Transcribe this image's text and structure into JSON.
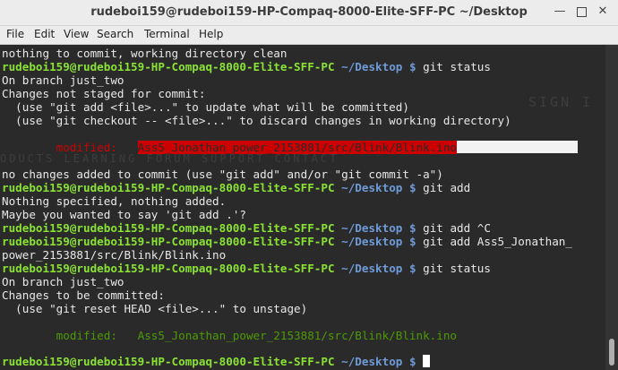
{
  "window": {
    "title": "rudeboi159@rudeboi159-HP-Compaq-8000-Elite-SFF-PC ~/Desktop"
  },
  "menu": [
    "File",
    "Edit",
    "View",
    "Search",
    "Terminal",
    "Help"
  ],
  "prompt": {
    "user": "rudeboi159@rudeboi159-HP-Compaq-8000-Elite-SFF-PC",
    "path": "~/Desktop",
    "symbol": "$"
  },
  "background_ghost": {
    "top": "SIGN I",
    "bottom": "ODUCTS   LEARNING   FORUM   SUPPORT   CONTACT"
  },
  "output": {
    "line1": "nothing to commit, working directory clean",
    "line3": "On branch just_two",
    "line4": "Changes not staged for commit:",
    "line5": "  (use \"git add <file>...\" to update what will be committed)",
    "line6": "  (use \"git checkout -- <file>...\" to discard changes in working directory)",
    "mod_label": "        modified:   ",
    "mod_file": "Ass5_Jonathan_power_2153881/src/Blink/Blink.ino",
    "line9": "no changes added to commit (use \"git add\" and/or \"git commit -a\")",
    "line11": "Nothing specified, nothing added.",
    "line12": "Maybe you wanted to say 'git add .'?",
    "line15": "power_2153881/src/Blink/Blink.ino",
    "line17": "On branch just_two",
    "line18": "Changes to be committed:",
    "line19": "  (use \"git reset HEAD <file>...\" to unstage)",
    "mod2_line": "        modified:   Ass5_Jonathan_power_2153881/src/Blink/Blink.ino"
  },
  "commands": {
    "c2": " git status",
    "c10": " git add",
    "c13": " git add ^C",
    "c14": " git add Ass5_Jonathan_",
    "c16": " git status",
    "c21": " "
  }
}
